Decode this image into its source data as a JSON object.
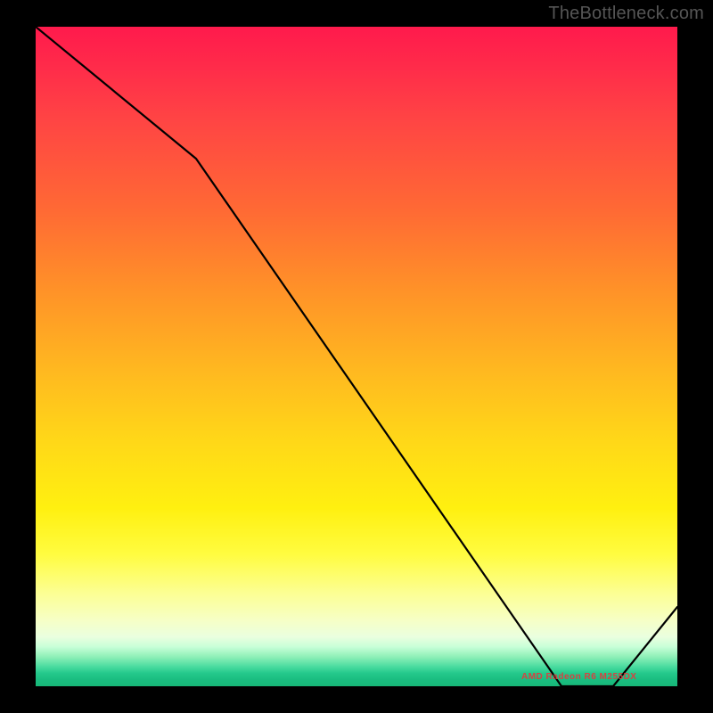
{
  "header": {
    "watermark": "TheBottleneck.com"
  },
  "annotation": {
    "label": "AMD Radeon R6 M255DX"
  },
  "chart_data": {
    "type": "line",
    "title": "",
    "xlabel": "",
    "ylabel": "",
    "xlim": [
      0,
      100
    ],
    "ylim": [
      0,
      100
    ],
    "series": [
      {
        "name": "curve",
        "x": [
          0,
          25,
          82,
          90,
          100
        ],
        "y": [
          100,
          80,
          0,
          0,
          12
        ]
      }
    ],
    "annotations": [
      {
        "text": "AMD Radeon R6 M255DX",
        "x": 84,
        "y": 1
      }
    ],
    "background": "red-yellow-green vertical gradient"
  }
}
